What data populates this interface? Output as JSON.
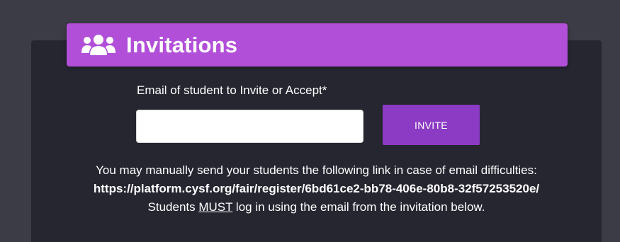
{
  "header": {
    "icon": "users-icon",
    "title": "Invitations",
    "color": "#b24fd8"
  },
  "form": {
    "label": "Email of student to Invite or Accept*",
    "email_value": "",
    "invite_label": "INVITE",
    "button_color": "#8b3bc4"
  },
  "info": {
    "line1": "You may manually send your students the following link in case of email difficulties:",
    "link": "https://platform.cysf.org/fair/register/6bd61ce2-bb78-406e-80b8-32f57253520e/",
    "line3_prefix": "Students ",
    "line3_emphasis": "MUST",
    "line3_suffix": " log in using the email from the invitation below."
  },
  "colors": {
    "page_bg": "#3c3c46",
    "card_bg": "#262631"
  }
}
